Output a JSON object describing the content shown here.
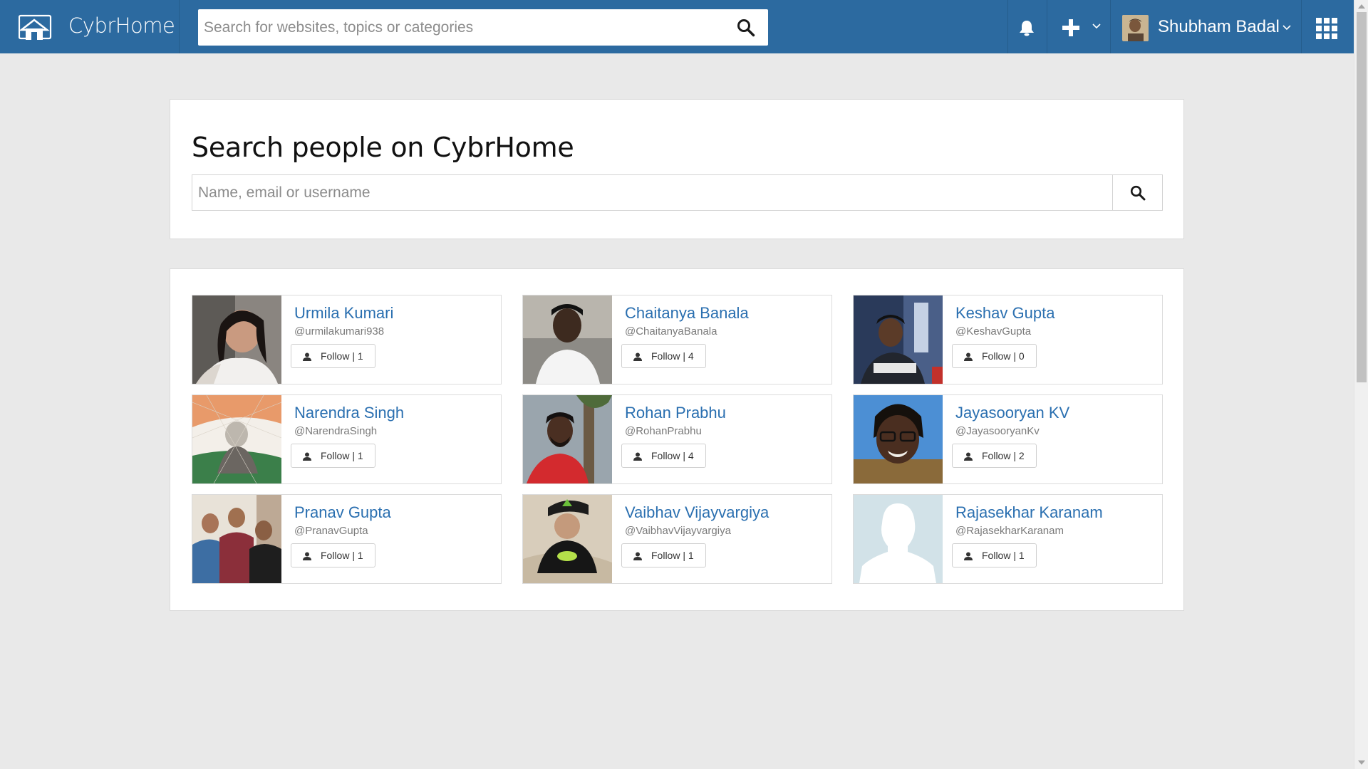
{
  "app": {
    "brand": "CybrHome",
    "top_search_placeholder": "Search for websites, topics or categories",
    "user_name": "Shubham Badal"
  },
  "colors": {
    "topbar": "#2c6aa0",
    "link": "#2a6fb0",
    "page_bg": "#e9e9e9"
  },
  "icons": {
    "logo": "house-icon",
    "top_search": "search-icon",
    "notifications": "bell-icon",
    "add": "plus-icon",
    "menu_caret": "chevron-down-icon",
    "apps": "grid-icon",
    "follow": "user-icon"
  },
  "people_search": {
    "title": "Search people on CybrHome",
    "placeholder": "Name, email or username"
  },
  "people": [
    {
      "name": "Urmila Kumari",
      "handle": "@urmilakumari938",
      "follow_label": "Follow | 1"
    },
    {
      "name": "Chaitanya Banala",
      "handle": "@ChaitanyaBanala",
      "follow_label": "Follow | 4"
    },
    {
      "name": "Keshav Gupta",
      "handle": "@KeshavGupta",
      "follow_label": "Follow | 0"
    },
    {
      "name": "Narendra Singh",
      "handle": "@NarendraSingh",
      "follow_label": "Follow | 1"
    },
    {
      "name": "Rohan Prabhu",
      "handle": "@RohanPrabhu",
      "follow_label": "Follow | 4"
    },
    {
      "name": "Jayasooryan KV",
      "handle": "@JayasooryanKv",
      "follow_label": "Follow | 2"
    },
    {
      "name": "Pranav Gupta",
      "handle": "@PranavGupta",
      "follow_label": "Follow | 1"
    },
    {
      "name": "Vaibhav Vijayvargiya",
      "handle": "@VaibhavVijayvargiya",
      "follow_label": "Follow | 1"
    },
    {
      "name": "Rajasekhar Karanam",
      "handle": "@RajasekharKaranam",
      "follow_label": "Follow | 1"
    }
  ]
}
